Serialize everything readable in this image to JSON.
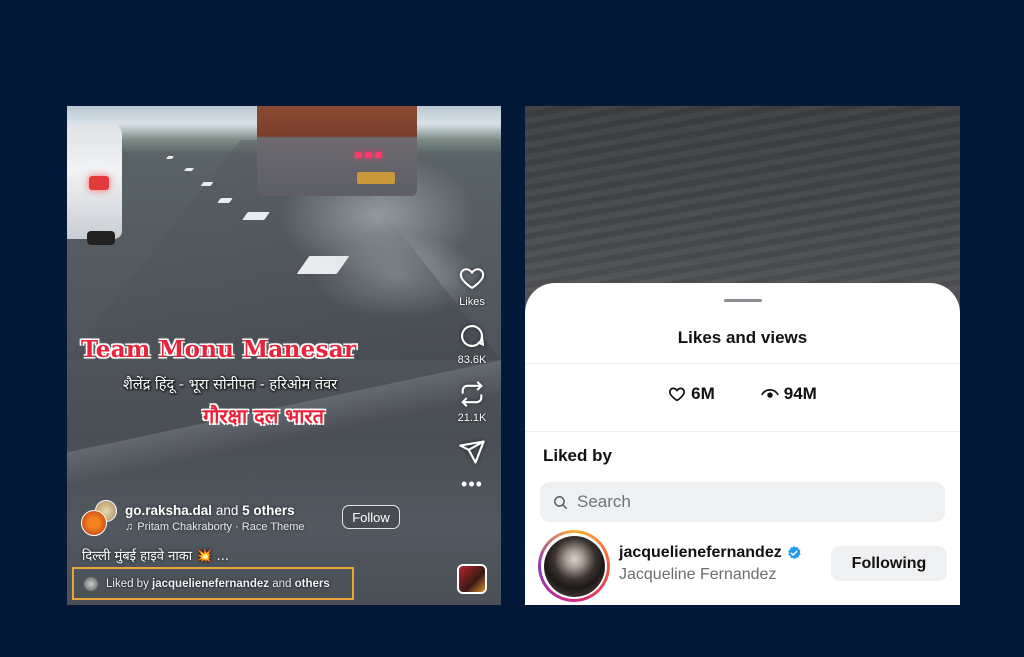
{
  "reel": {
    "overlay_title": "Team Monu Manesar",
    "overlay_subtitle": "शैलेंद्र हिंदू - भूरा सोनीपत - हरिओम तंवर",
    "overlay_org": "गौरक्षा दल भारत",
    "actions": {
      "likes_label": "Likes",
      "comments_count": "83.6K",
      "reposts_count": "21.1K",
      "more": "•••"
    },
    "author": {
      "name": "go.raksha.dal",
      "and_text": "and",
      "others": "5 others"
    },
    "music": "Pritam Chakraborty · Race Theme",
    "follow_label": "Follow",
    "caption": "दिल्ली मुंबई हाइवे नाका 💥 ...",
    "liked_by": {
      "prefix": "Liked by",
      "user": "jacquelienefernandez",
      "suffix": "and",
      "others": "others"
    },
    "highlight_color": "#e9a43a"
  },
  "likes_sheet": {
    "title": "Likes and views",
    "likes_count": "6M",
    "views_count": "94M",
    "liked_by_heading": "Liked by",
    "search_placeholder": "Search",
    "user": {
      "username": "jacquelienefernandez",
      "full_name": "Jacqueline Fernandez",
      "verified": true,
      "button_label": "Following"
    }
  },
  "colors": {
    "page_background": "#04193a",
    "verified_blue": "#1d9bf0",
    "overlay_red": "#e8243c"
  }
}
